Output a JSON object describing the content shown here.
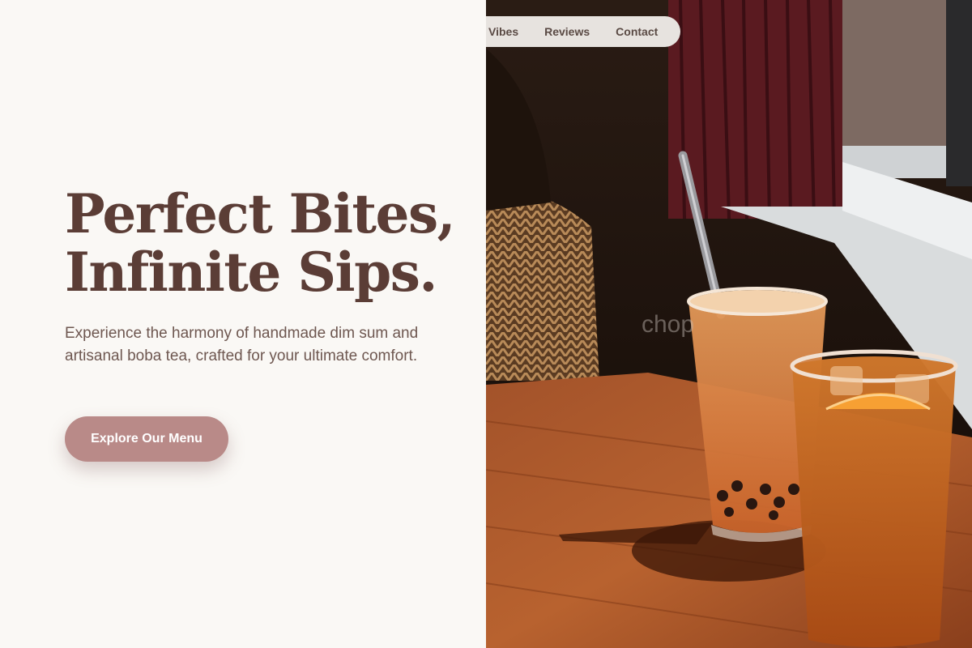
{
  "nav": {
    "links": [
      {
        "label": "Vibes"
      },
      {
        "label": "Reviews"
      },
      {
        "label": "Contact"
      }
    ]
  },
  "hero": {
    "title_line1": "Perfect Bites,",
    "title_line2": "Infinite Sips.",
    "subtitle": "Experience the harmony of handmade dim sum and artisanal boba tea, crafted for your ultimate comfort.",
    "cta_label": "Explore Our Menu"
  },
  "photo": {
    "overlay_text": "chop"
  },
  "colors": {
    "background": "#faf8f5",
    "heading": "#5b3d36",
    "body_text": "#6e5750",
    "cta_background": "#b98a88",
    "cta_text": "#ffffff",
    "nav_background": "#e7e3df",
    "nav_text": "#5a4a44"
  }
}
